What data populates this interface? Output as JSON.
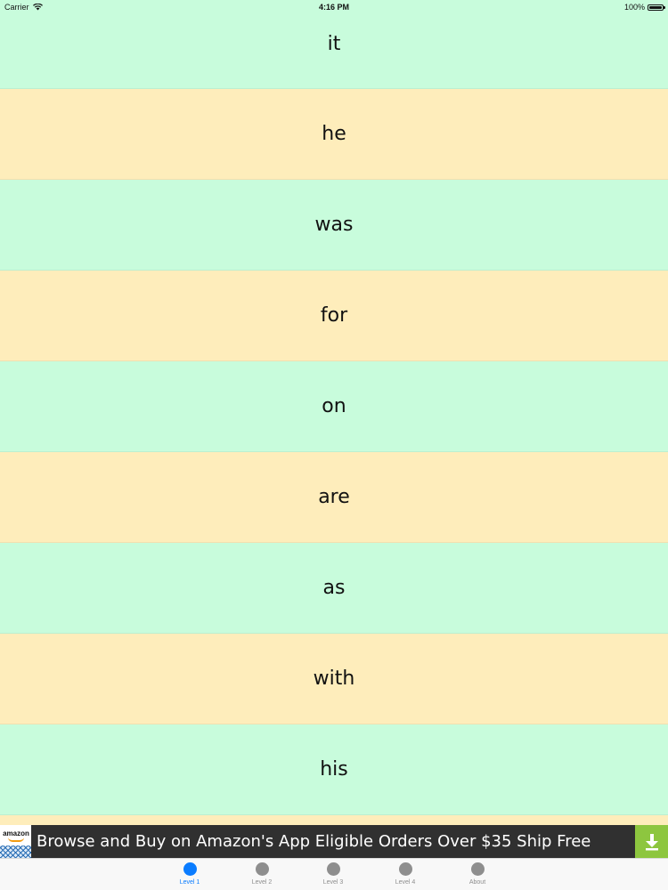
{
  "status_bar": {
    "carrier": "Carrier",
    "time": "4:16 PM",
    "battery": "100%"
  },
  "words": [
    "it",
    "he",
    "was",
    "for",
    "on",
    "are",
    "as",
    "with",
    "his",
    ""
  ],
  "ad": {
    "logo_text": "amazon",
    "text": "Browse and Buy on Amazon's App Eligible Orders Over $35 Ship Free"
  },
  "tabs": [
    {
      "label": "Level 1",
      "active": true
    },
    {
      "label": "Level 2",
      "active": false
    },
    {
      "label": "Level 3",
      "active": false
    },
    {
      "label": "Level 4",
      "active": false
    },
    {
      "label": "About",
      "active": false
    }
  ],
  "colors": {
    "row_green": "#c8fcdc",
    "row_yellow": "#feedbb",
    "tab_active": "#0a7cff",
    "tab_inactive": "#8e8e8e",
    "ad_background": "#303030",
    "ad_download": "#8dc63f"
  },
  "icons": {
    "wifi": "wifi-icon",
    "battery": "battery-icon",
    "download": "download-icon",
    "tab": "circle-icon"
  }
}
